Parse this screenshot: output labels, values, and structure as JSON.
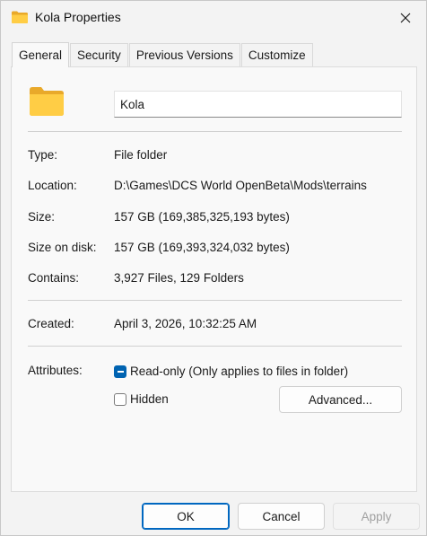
{
  "window": {
    "title": "Kola Properties",
    "title_icon": "folder-icon",
    "close_icon": "close-icon"
  },
  "tabs": [
    {
      "label": "General",
      "active": true
    },
    {
      "label": "Security",
      "active": false
    },
    {
      "label": "Previous Versions",
      "active": false
    },
    {
      "label": "Customize",
      "active": false
    }
  ],
  "general": {
    "icon": "folder-icon",
    "name": "Kola",
    "type": {
      "label": "Type:",
      "value": "File folder"
    },
    "location": {
      "label": "Location:",
      "value": "D:\\Games\\DCS World OpenBeta\\Mods\\terrains"
    },
    "size": {
      "label": "Size:",
      "value": "157 GB (169,385,325,193 bytes)"
    },
    "size_on_disk": {
      "label": "Size on disk:",
      "value": "157 GB (169,393,324,032 bytes)"
    },
    "contains": {
      "label": "Contains:",
      "value": "3,927 Files, 129 Folders"
    },
    "created": {
      "label": "Created:",
      "value": "April 3, 2026, 10:32:25 AM"
    },
    "attributes": {
      "label": "Attributes:",
      "readonly": {
        "label": "Read-only (Only applies to files in folder)",
        "state": "indeterminate"
      },
      "hidden": {
        "label": "Hidden",
        "state": "unchecked"
      },
      "advanced_button": "Advanced..."
    }
  },
  "footer": {
    "ok": "OK",
    "cancel": "Cancel",
    "apply": "Apply",
    "apply_enabled": false
  },
  "colors": {
    "accent": "#0067c0",
    "folder": "#f8c83a",
    "background": "#f3f3f3"
  }
}
